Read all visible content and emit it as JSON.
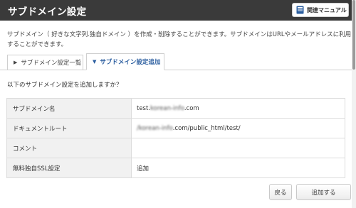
{
  "header": {
    "title": "サブドメイン設定",
    "manual_label": "関連マニュアル"
  },
  "description": "サブドメイン（ 好きな文字列.独自ドメイン ）を作成・削除することができます。サブドメインはURLやメールアドレスに利用することができます。",
  "tabs": [
    {
      "label": "サブドメイン設定一覧",
      "active": false
    },
    {
      "label": "サブドメイン設定追加",
      "active": true
    }
  ],
  "question": "以下のサブドメイン設定を追加しますか？",
  "table": {
    "rows": [
      {
        "label": "サブドメイン名",
        "value_prefix": "test.",
        "value_blur": "korean-info",
        "value_suffix": ".com"
      },
      {
        "label": "ドキュメントルート",
        "value_prefix": "",
        "value_blur": "/korean-info",
        "value_suffix": ".com/public_html/test/"
      },
      {
        "label": "コメント",
        "value_prefix": "",
        "value_blur": "",
        "value_suffix": ""
      },
      {
        "label": "無料独自SSL設定",
        "value_prefix": "",
        "value_blur": "",
        "value_suffix": "追加"
      }
    ]
  },
  "buttons": {
    "back": "戻る",
    "submit": "追加する"
  },
  "colors": {
    "header_bg": "#3a3a3a",
    "active_tab_text": "#2a5d9f",
    "manual_icon": "#2a5d9f"
  }
}
